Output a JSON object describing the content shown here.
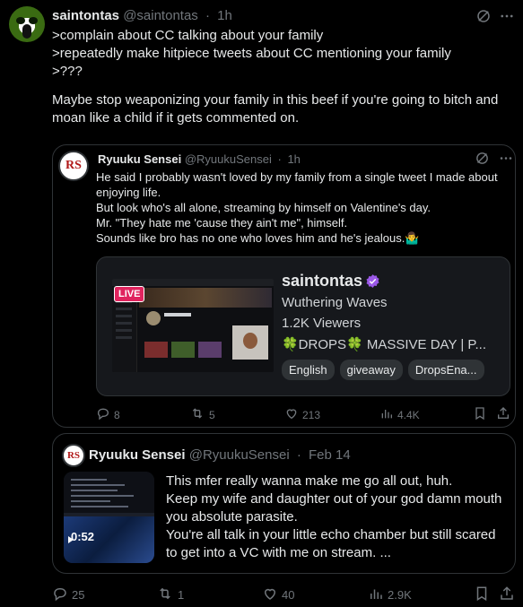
{
  "main_tweet": {
    "display_name": "saintontas",
    "handle": "@saintontas",
    "separator": "·",
    "time": "1h",
    "lines": [
      ">complain about CC talking about your family",
      ">repeatedly make hitpiece tweets about CC mentioning your family",
      ">???"
    ],
    "paragraph": "Maybe stop weaponizing your family in this beef if you're going to bitch and moan like a child if it gets commented on.",
    "actions": {
      "replies": "25",
      "reposts": "1",
      "likes": "40",
      "views": "2.9K"
    }
  },
  "quote_one": {
    "display_name": "Ryuuku Sensei",
    "handle": "@RyuukuSensei",
    "separator": "·",
    "time": "1h",
    "lines": [
      "He said I probably wasn't loved by my family from a single tweet I made about enjoying life.",
      "But look who's all alone, streaming by himself on Valentine's day.",
      "Mr. \"They hate me 'cause they ain't me\", himself.",
      "Sounds like bro has no one who loves him and he's jealous.🤷‍♂️"
    ],
    "stream_card": {
      "live_badge": "LIVE",
      "channel": "saintontas",
      "game": "Wuthering Waves",
      "viewers": "1.2K Viewers",
      "title_pre": "🍀DROPS🍀 MASSIVE DAY | P...",
      "tags": [
        "English",
        "giveaway",
        "DropsEna..."
      ]
    },
    "actions": {
      "replies": "8",
      "reposts": "5",
      "likes": "213",
      "views": "4.4K"
    }
  },
  "quote_two": {
    "display_name": "Ryuuku Sensei",
    "handle": "@RyuukuSensei",
    "separator": "·",
    "date": "Feb 14",
    "video_duration": "0:52",
    "lines": [
      "This mfer really wanna make me go all out, huh.",
      "Keep my wife and daughter out of your god damn mouth you absolute parasite.",
      "You're all talk in your little echo chamber but still scared to get into a VC with me on stream. ..."
    ]
  },
  "colors": {
    "background": "#000000",
    "text": "#e7e9ea",
    "muted": "#71767b",
    "border": "#2f3336",
    "verified": "#9b59e8",
    "live": "#e0245e"
  }
}
